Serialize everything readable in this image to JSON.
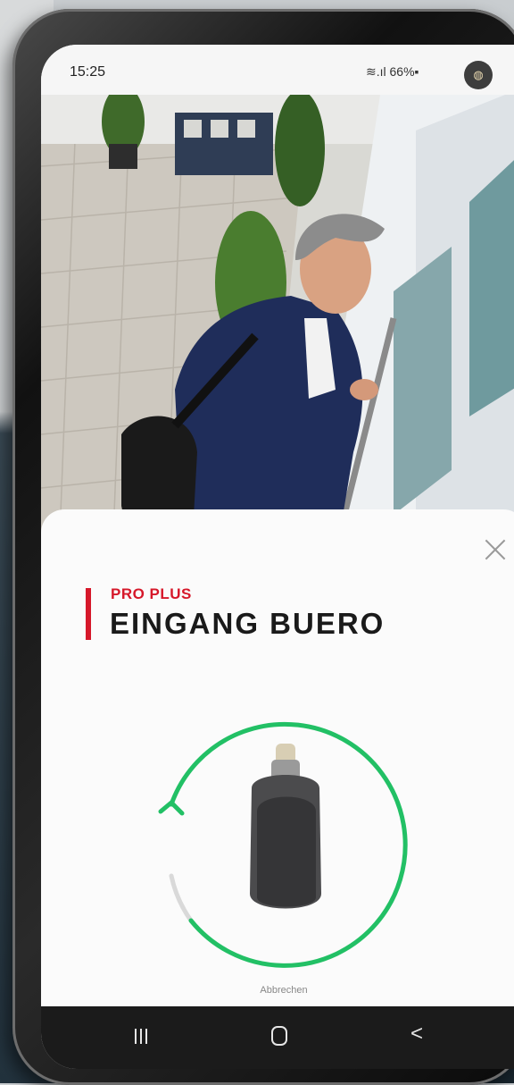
{
  "status_bar": {
    "time": "15:25",
    "icons": "≋.ıl 66%▪",
    "battery": "66%",
    "avatar_letter": "◍"
  },
  "photo": {
    "description_icon": "doorway-photo"
  },
  "sheet": {
    "subtitle": "PRO PLUS",
    "title": "EINGANG BUERO",
    "cancel_label": "Abbrechen",
    "accent_color": "#d6182a",
    "progress_color": "#22c065",
    "progress": 0.78
  },
  "nav": {
    "recents": "|||",
    "home": "○",
    "back": "<"
  }
}
